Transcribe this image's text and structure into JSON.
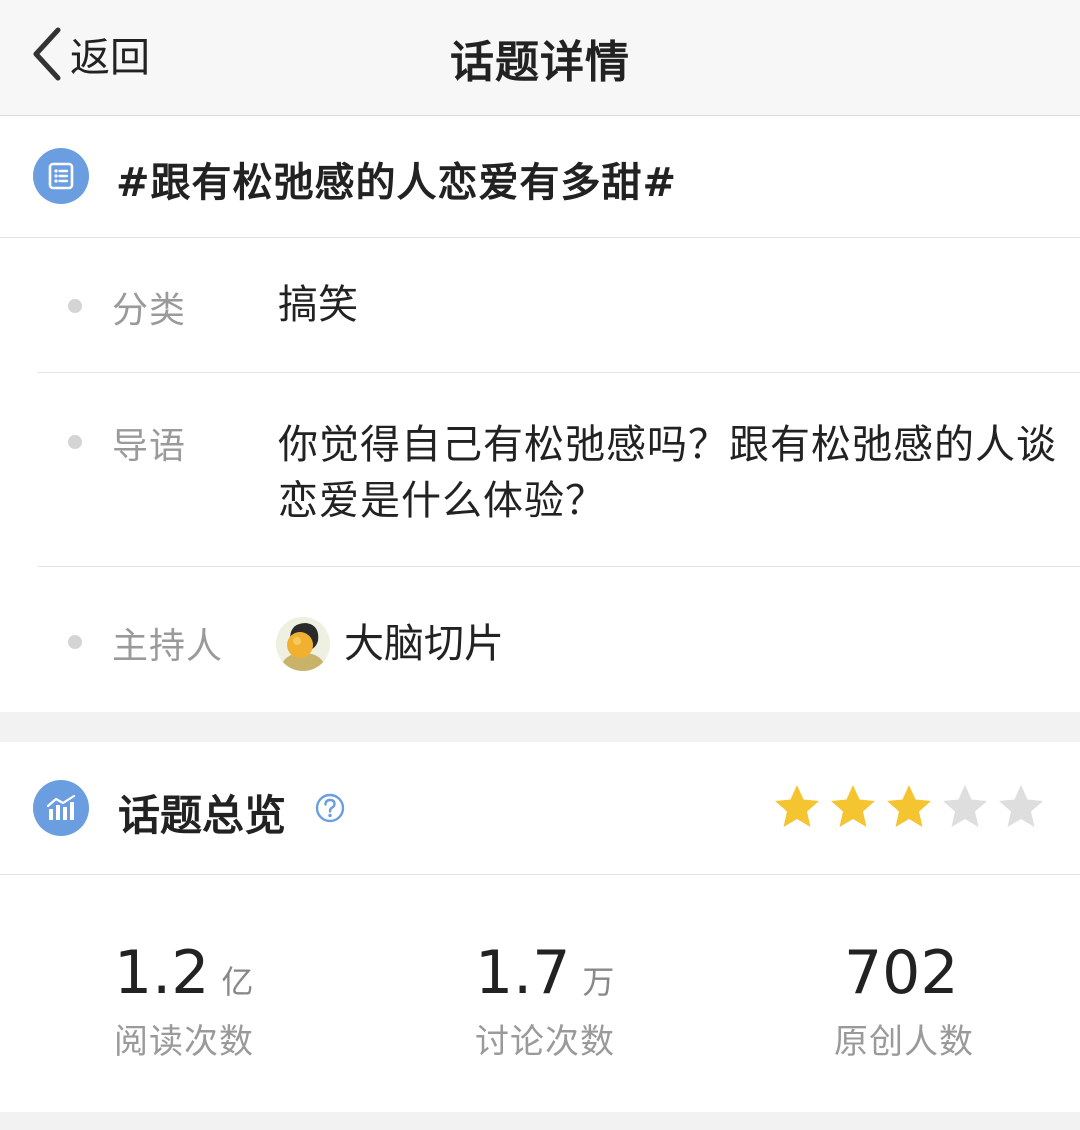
{
  "navbar": {
    "back_label": "返回",
    "title": "话题详情"
  },
  "topic": {
    "icon": "list-icon",
    "title": "#跟有松弛感的人恋爱有多甜#",
    "category_label": "分类",
    "category_value": "搞笑",
    "intro_label": "导语",
    "intro_value": "你觉得自己有松弛感吗？跟有松弛感的人谈恋爱是什么体验？",
    "host_label": "主持人",
    "host_name": "大脑切片"
  },
  "overview": {
    "icon": "bar-chart-icon",
    "title": "话题总览",
    "help_icon": "question-circle-icon",
    "rating": {
      "filled": 3,
      "total": 5
    },
    "stats": [
      {
        "value": "1.2",
        "unit": "亿",
        "label": "阅读次数"
      },
      {
        "value": "1.7",
        "unit": "万",
        "label": "讨论次数"
      },
      {
        "value": "702",
        "unit": "",
        "label": "原创人数"
      }
    ]
  },
  "colors": {
    "accent_blue": "#6a9ee0",
    "star_filled": "#f5c431",
    "star_empty": "#dedede",
    "label_gray": "#9a9a9a"
  }
}
